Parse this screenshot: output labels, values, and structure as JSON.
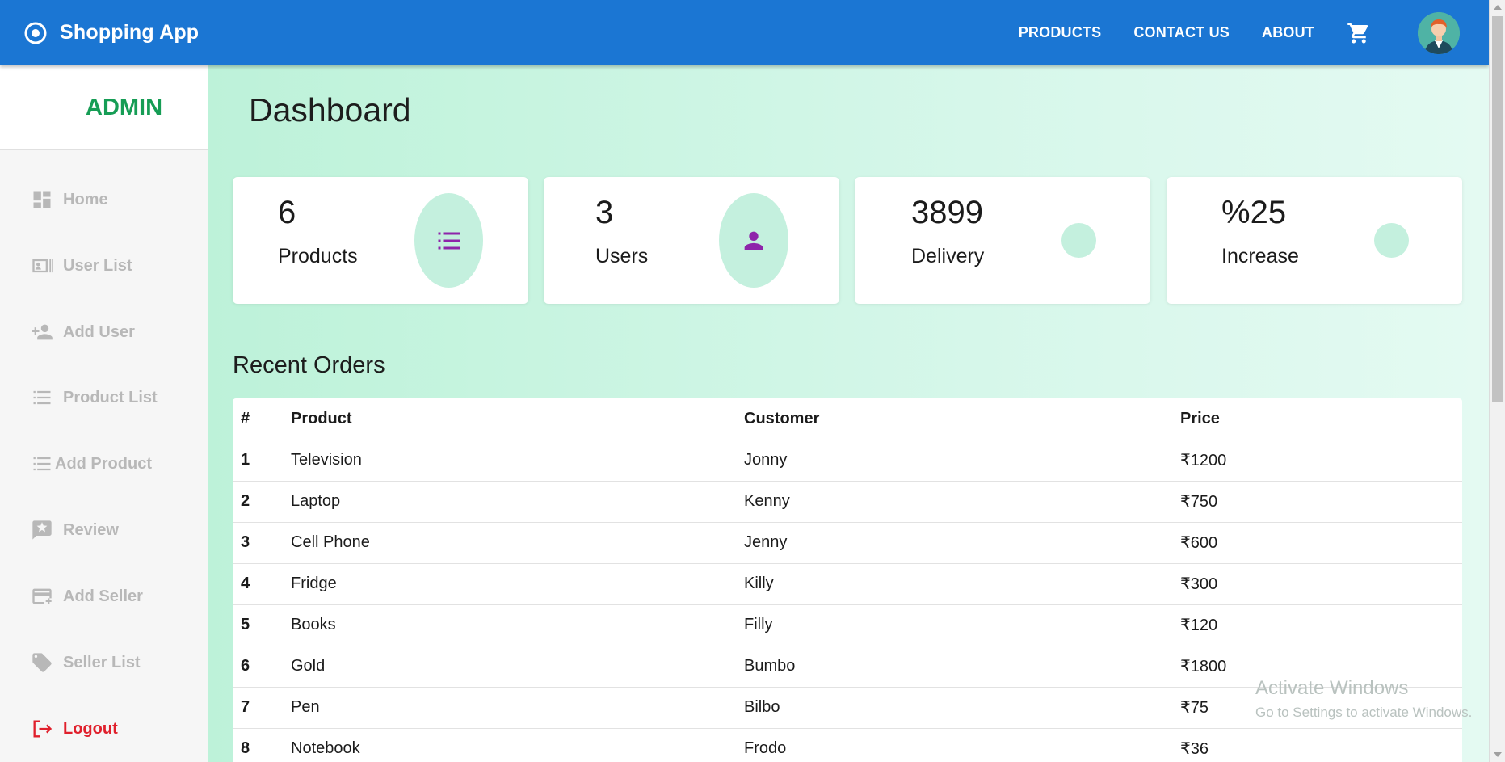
{
  "appbar": {
    "title": "Shopping App",
    "links": [
      "PRODUCTS",
      "CONTACT US",
      "ABOUT"
    ],
    "color": "#1b76d3"
  },
  "sidebar": {
    "title": "ADMIN",
    "items": [
      {
        "label": "Home",
        "icon": "dashboard-icon"
      },
      {
        "label": "User List",
        "icon": "user-card-icon"
      },
      {
        "label": "Add User",
        "icon": "person-add-icon"
      },
      {
        "label": "Product List",
        "icon": "list-icon"
      },
      {
        "label": "Add Product",
        "icon": "list-add-icon"
      },
      {
        "label": "Review",
        "icon": "review-icon"
      },
      {
        "label": "Add Seller",
        "icon": "card-add-icon"
      },
      {
        "label": "Seller List",
        "icon": "tag-icon"
      },
      {
        "label": "Logout",
        "icon": "logout-icon"
      }
    ]
  },
  "dashboard": {
    "title": "Dashboard",
    "cards": [
      {
        "value": "6",
        "label": "Products",
        "icon": "list-icon"
      },
      {
        "value": "3",
        "label": "Users",
        "icon": "person-icon"
      },
      {
        "value": "3899",
        "label": "Delivery"
      },
      {
        "value": "%25",
        "label": "Increase"
      }
    ]
  },
  "orders": {
    "title": "Recent Orders",
    "headers": [
      "#",
      "Product",
      "Customer",
      "Price"
    ],
    "rows": [
      [
        "1",
        "Television",
        "Jonny",
        "₹1200"
      ],
      [
        "2",
        "Laptop",
        "Kenny",
        "₹750"
      ],
      [
        "3",
        "Cell Phone",
        "Jenny",
        "₹600"
      ],
      [
        "4",
        "Fridge",
        "Killy",
        "₹300"
      ],
      [
        "5",
        "Books",
        "Filly",
        "₹120"
      ],
      [
        "6",
        "Gold",
        "Bumbo",
        "₹1800"
      ],
      [
        "7",
        "Pen",
        "Bilbo",
        "₹75"
      ],
      [
        "8",
        "Notebook",
        "Frodo",
        "₹36"
      ]
    ]
  },
  "watermark": {
    "title": "Activate Windows",
    "subtitle": "Go to Settings to activate Windows."
  }
}
